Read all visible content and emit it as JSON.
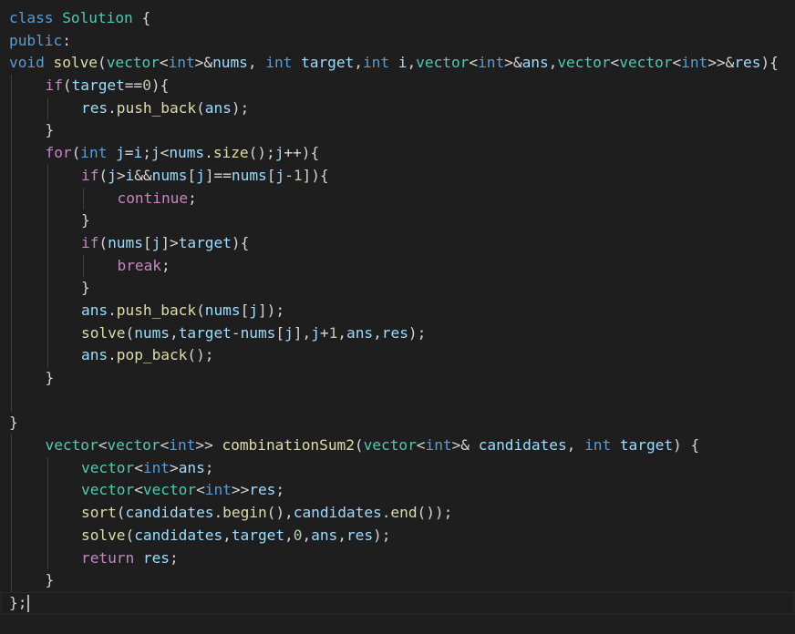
{
  "editor": {
    "language": "cpp",
    "cursor_line": 27,
    "lines": [
      {
        "indent": 0,
        "tokens": [
          [
            "kw",
            "class"
          ],
          [
            "plain",
            " "
          ],
          [
            "type",
            "Solution"
          ],
          [
            "plain",
            " {"
          ]
        ]
      },
      {
        "indent": 0,
        "tokens": [
          [
            "kw",
            "public"
          ],
          [
            "plain",
            ":"
          ]
        ]
      },
      {
        "indent": 0,
        "tokens": [
          [
            "kw",
            "void"
          ],
          [
            "plain",
            " "
          ],
          [
            "fn",
            "solve"
          ],
          [
            "plain",
            "("
          ],
          [
            "type",
            "vector"
          ],
          [
            "plain",
            "<"
          ],
          [
            "kw",
            "int"
          ],
          [
            "plain",
            ">&"
          ],
          [
            "var",
            "nums"
          ],
          [
            "plain",
            ", "
          ],
          [
            "kw",
            "int"
          ],
          [
            "plain",
            " "
          ],
          [
            "var",
            "target"
          ],
          [
            "plain",
            ","
          ],
          [
            "kw",
            "int"
          ],
          [
            "plain",
            " "
          ],
          [
            "var",
            "i"
          ],
          [
            "plain",
            ","
          ],
          [
            "type",
            "vector"
          ],
          [
            "plain",
            "<"
          ],
          [
            "kw",
            "int"
          ],
          [
            "plain",
            ">&"
          ],
          [
            "var",
            "ans"
          ],
          [
            "plain",
            ","
          ],
          [
            "type",
            "vector"
          ],
          [
            "plain",
            "<"
          ],
          [
            "type",
            "vector"
          ],
          [
            "plain",
            "<"
          ],
          [
            "kw",
            "int"
          ],
          [
            "plain",
            ">>&"
          ],
          [
            "var",
            "res"
          ],
          [
            "plain",
            "){"
          ]
        ]
      },
      {
        "indent": 1,
        "tokens": [
          [
            "ctl",
            "if"
          ],
          [
            "plain",
            "("
          ],
          [
            "var",
            "target"
          ],
          [
            "plain",
            "=="
          ],
          [
            "num",
            "0"
          ],
          [
            "plain",
            "){"
          ]
        ]
      },
      {
        "indent": 2,
        "tokens": [
          [
            "var",
            "res"
          ],
          [
            "plain",
            "."
          ],
          [
            "fn",
            "push_back"
          ],
          [
            "plain",
            "("
          ],
          [
            "var",
            "ans"
          ],
          [
            "plain",
            ");"
          ]
        ]
      },
      {
        "indent": 1,
        "tokens": [
          [
            "plain",
            "}"
          ]
        ]
      },
      {
        "indent": 1,
        "tokens": [
          [
            "ctl",
            "for"
          ],
          [
            "plain",
            "("
          ],
          [
            "kw",
            "int"
          ],
          [
            "plain",
            " "
          ],
          [
            "var",
            "j"
          ],
          [
            "plain",
            "="
          ],
          [
            "var",
            "i"
          ],
          [
            "plain",
            ";"
          ],
          [
            "var",
            "j"
          ],
          [
            "plain",
            "<"
          ],
          [
            "var",
            "nums"
          ],
          [
            "plain",
            "."
          ],
          [
            "fn",
            "size"
          ],
          [
            "plain",
            "();"
          ],
          [
            "var",
            "j"
          ],
          [
            "plain",
            "++){"
          ]
        ]
      },
      {
        "indent": 2,
        "tokens": [
          [
            "ctl",
            "if"
          ],
          [
            "plain",
            "("
          ],
          [
            "var",
            "j"
          ],
          [
            "plain",
            ">"
          ],
          [
            "var",
            "i"
          ],
          [
            "plain",
            "&&"
          ],
          [
            "var",
            "nums"
          ],
          [
            "plain",
            "["
          ],
          [
            "var",
            "j"
          ],
          [
            "plain",
            "]=="
          ],
          [
            "var",
            "nums"
          ],
          [
            "plain",
            "["
          ],
          [
            "var",
            "j"
          ],
          [
            "plain",
            "-"
          ],
          [
            "num",
            "1"
          ],
          [
            "plain",
            "]){"
          ]
        ]
      },
      {
        "indent": 3,
        "tokens": [
          [
            "ctl",
            "continue"
          ],
          [
            "plain",
            ";"
          ]
        ]
      },
      {
        "indent": 2,
        "tokens": [
          [
            "plain",
            "}"
          ]
        ]
      },
      {
        "indent": 2,
        "tokens": [
          [
            "ctl",
            "if"
          ],
          [
            "plain",
            "("
          ],
          [
            "var",
            "nums"
          ],
          [
            "plain",
            "["
          ],
          [
            "var",
            "j"
          ],
          [
            "plain",
            "]>"
          ],
          [
            "var",
            "target"
          ],
          [
            "plain",
            "){"
          ]
        ]
      },
      {
        "indent": 3,
        "tokens": [
          [
            "ctl",
            "break"
          ],
          [
            "plain",
            ";"
          ]
        ]
      },
      {
        "indent": 2,
        "tokens": [
          [
            "plain",
            "}"
          ]
        ]
      },
      {
        "indent": 2,
        "tokens": [
          [
            "var",
            "ans"
          ],
          [
            "plain",
            "."
          ],
          [
            "fn",
            "push_back"
          ],
          [
            "plain",
            "("
          ],
          [
            "var",
            "nums"
          ],
          [
            "plain",
            "["
          ],
          [
            "var",
            "j"
          ],
          [
            "plain",
            "]);"
          ]
        ]
      },
      {
        "indent": 2,
        "tokens": [
          [
            "fn",
            "solve"
          ],
          [
            "plain",
            "("
          ],
          [
            "var",
            "nums"
          ],
          [
            "plain",
            ","
          ],
          [
            "var",
            "target"
          ],
          [
            "plain",
            "-"
          ],
          [
            "var",
            "nums"
          ],
          [
            "plain",
            "["
          ],
          [
            "var",
            "j"
          ],
          [
            "plain",
            "],"
          ],
          [
            "var",
            "j"
          ],
          [
            "plain",
            "+"
          ],
          [
            "num",
            "1"
          ],
          [
            "plain",
            ","
          ],
          [
            "var",
            "ans"
          ],
          [
            "plain",
            ","
          ],
          [
            "var",
            "res"
          ],
          [
            "plain",
            ");"
          ]
        ]
      },
      {
        "indent": 2,
        "tokens": [
          [
            "var",
            "ans"
          ],
          [
            "plain",
            "."
          ],
          [
            "fn",
            "pop_back"
          ],
          [
            "plain",
            "();"
          ]
        ]
      },
      {
        "indent": 1,
        "tokens": [
          [
            "plain",
            "}"
          ]
        ]
      },
      {
        "indent": 0,
        "guides": 1,
        "tokens": []
      },
      {
        "indent": 0,
        "tokens": [
          [
            "plain",
            "}"
          ]
        ]
      },
      {
        "indent": 1,
        "tokens": [
          [
            "type",
            "vector"
          ],
          [
            "plain",
            "<"
          ],
          [
            "type",
            "vector"
          ],
          [
            "plain",
            "<"
          ],
          [
            "kw",
            "int"
          ],
          [
            "plain",
            ">> "
          ],
          [
            "fn",
            "combinationSum2"
          ],
          [
            "plain",
            "("
          ],
          [
            "type",
            "vector"
          ],
          [
            "plain",
            "<"
          ],
          [
            "kw",
            "int"
          ],
          [
            "plain",
            ">& "
          ],
          [
            "var",
            "candidates"
          ],
          [
            "plain",
            ", "
          ],
          [
            "kw",
            "int"
          ],
          [
            "plain",
            " "
          ],
          [
            "var",
            "target"
          ],
          [
            "plain",
            ") {"
          ]
        ]
      },
      {
        "indent": 2,
        "tokens": [
          [
            "type",
            "vector"
          ],
          [
            "plain",
            "<"
          ],
          [
            "kw",
            "int"
          ],
          [
            "plain",
            ">"
          ],
          [
            "var",
            "ans"
          ],
          [
            "plain",
            ";"
          ]
        ]
      },
      {
        "indent": 2,
        "tokens": [
          [
            "type",
            "vector"
          ],
          [
            "plain",
            "<"
          ],
          [
            "type",
            "vector"
          ],
          [
            "plain",
            "<"
          ],
          [
            "kw",
            "int"
          ],
          [
            "plain",
            ">>"
          ],
          [
            "var",
            "res"
          ],
          [
            "plain",
            ";"
          ]
        ]
      },
      {
        "indent": 2,
        "tokens": [
          [
            "fn",
            "sort"
          ],
          [
            "plain",
            "("
          ],
          [
            "var",
            "candidates"
          ],
          [
            "plain",
            "."
          ],
          [
            "fn",
            "begin"
          ],
          [
            "plain",
            "(),"
          ],
          [
            "var",
            "candidates"
          ],
          [
            "plain",
            "."
          ],
          [
            "fn",
            "end"
          ],
          [
            "plain",
            "());"
          ]
        ]
      },
      {
        "indent": 2,
        "tokens": [
          [
            "fn",
            "solve"
          ],
          [
            "plain",
            "("
          ],
          [
            "var",
            "candidates"
          ],
          [
            "plain",
            ","
          ],
          [
            "var",
            "target"
          ],
          [
            "plain",
            ","
          ],
          [
            "num",
            "0"
          ],
          [
            "plain",
            ","
          ],
          [
            "var",
            "ans"
          ],
          [
            "plain",
            ","
          ],
          [
            "var",
            "res"
          ],
          [
            "plain",
            ");"
          ]
        ]
      },
      {
        "indent": 2,
        "tokens": [
          [
            "ctl",
            "return"
          ],
          [
            "plain",
            " "
          ],
          [
            "var",
            "res"
          ],
          [
            "plain",
            ";"
          ]
        ]
      },
      {
        "indent": 1,
        "tokens": [
          [
            "plain",
            "}"
          ]
        ]
      },
      {
        "indent": 0,
        "tokens": [
          [
            "plain",
            "};"
          ]
        ]
      }
    ]
  }
}
